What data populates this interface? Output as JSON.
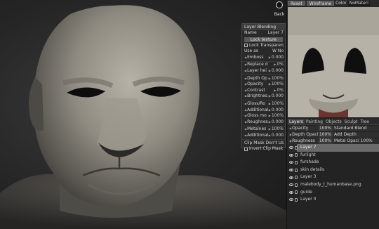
{
  "back": {
    "label": "Back"
  },
  "blend_panel": {
    "title": "Layer Blending",
    "name_label": "Name",
    "name_value": "Layer 7",
    "lock_texture": "Lock texture",
    "lock_transparency": "Lock Transparency",
    "use_as_label": "Use as",
    "use_as_value": "W No",
    "rows": [
      {
        "label": "Emboss",
        "value": "0.000"
      },
      {
        "label": "Replace d",
        "value": "0%"
      },
      {
        "label": "Layer hei",
        "value": "0.000"
      },
      {
        "label": "Depth Op",
        "value": "100%"
      },
      {
        "label": "Opacity",
        "value": "100%"
      },
      {
        "label": "Contrast",
        "value": "0%"
      },
      {
        "label": "Brightnes",
        "value": "0.000"
      },
      {
        "label": "Gloss/Ro",
        "value": "100%"
      },
      {
        "label": "Additional",
        "value": "0.000"
      },
      {
        "label": "Gloss mo",
        "value": "100%"
      },
      {
        "label": "Roughnes",
        "value": "0.000"
      },
      {
        "label": "Metalnes",
        "value": "100%"
      },
      {
        "label": "Additional",
        "value": "0.000"
      }
    ],
    "clip_mask": "Clip Mask Don't Us",
    "invert_clip": "Invert Clip Mask"
  },
  "topbar": {
    "reset": "Reset",
    "wireframe": "Wireframe",
    "color": "Color",
    "material": "NoMateri"
  },
  "tabs": [
    "Layers",
    "Painting",
    "Objects",
    "Sculpt",
    "Tree"
  ],
  "props": [
    {
      "label": "Opacity",
      "value": "100%",
      "extra": "Standard Blend"
    },
    {
      "label": "Depth Opaci",
      "value": "100%",
      "extra": "Add Depth"
    },
    {
      "label": "Roughness",
      "value": "100%",
      "extra": "Metal Opaci 100%"
    }
  ],
  "layers": [
    {
      "name": "Layer 7"
    },
    {
      "name": "furlight"
    },
    {
      "name": "furshade"
    },
    {
      "name": "skin details"
    },
    {
      "name": "Layer 3"
    },
    {
      "name": "malebody_t_humanbase.png"
    },
    {
      "name": "guide"
    },
    {
      "name": "Layer 0"
    }
  ],
  "colors": {
    "panel_bg": "#2a2a2a",
    "selected_layer": "#6a6a6a",
    "skin": "#a19d92"
  }
}
